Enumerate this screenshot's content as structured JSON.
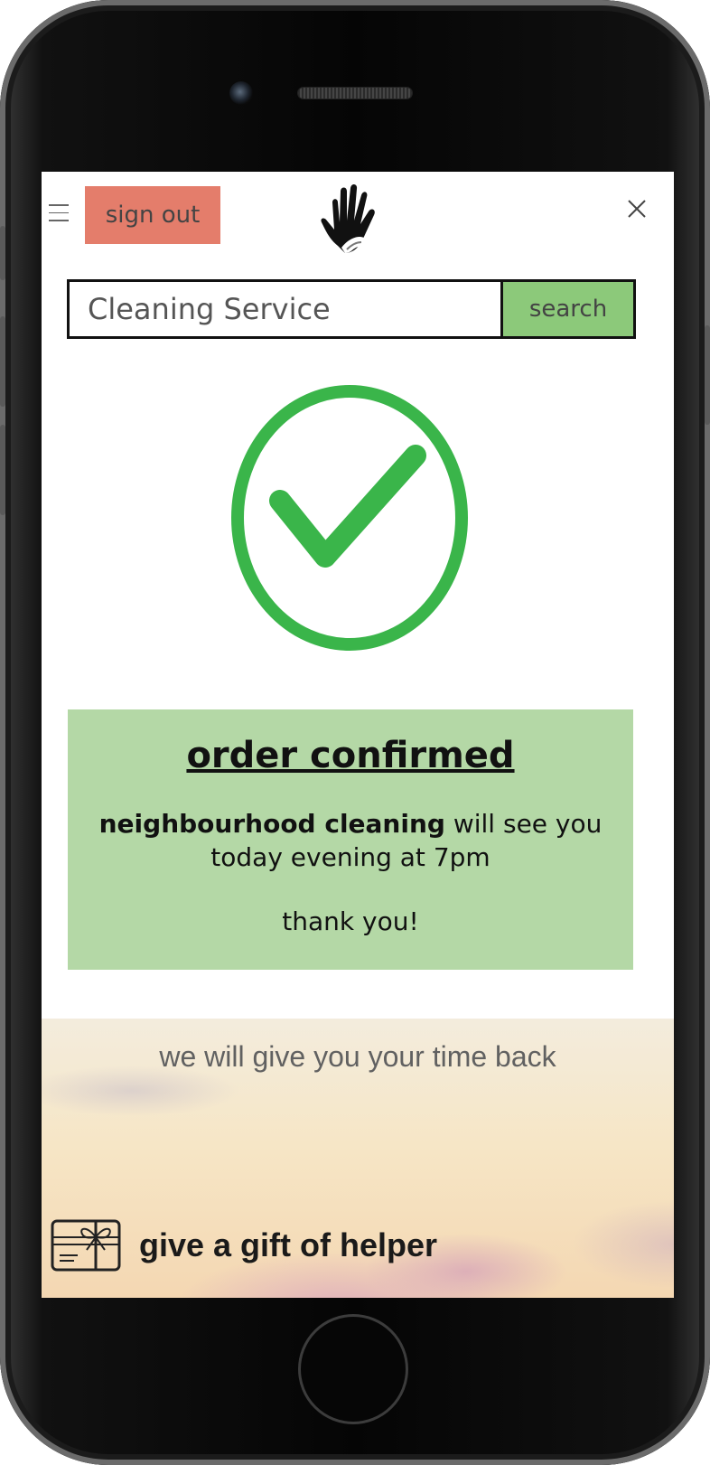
{
  "header": {
    "sign_out_label": "sign out"
  },
  "search": {
    "value": "Cleaning Service",
    "button_label": "search"
  },
  "confirmation": {
    "title": "order confirmed",
    "provider": "neighbourhood cleaning",
    "message_rest": " will see you today evening at 7pm",
    "thanks": "thank you!"
  },
  "banner": {
    "tagline": "we will give you your time back",
    "gift_label": "give a gift of helper"
  },
  "colors": {
    "sign_out_bg": "#e47d6b",
    "search_button_bg": "#8cc97a",
    "check_green": "#3ab54a",
    "confirm_bg": "#b4d8a6"
  },
  "icons": [
    "menu-icon",
    "hand-logo-icon",
    "close-icon",
    "checkmark-circle-icon",
    "gift-card-icon"
  ]
}
